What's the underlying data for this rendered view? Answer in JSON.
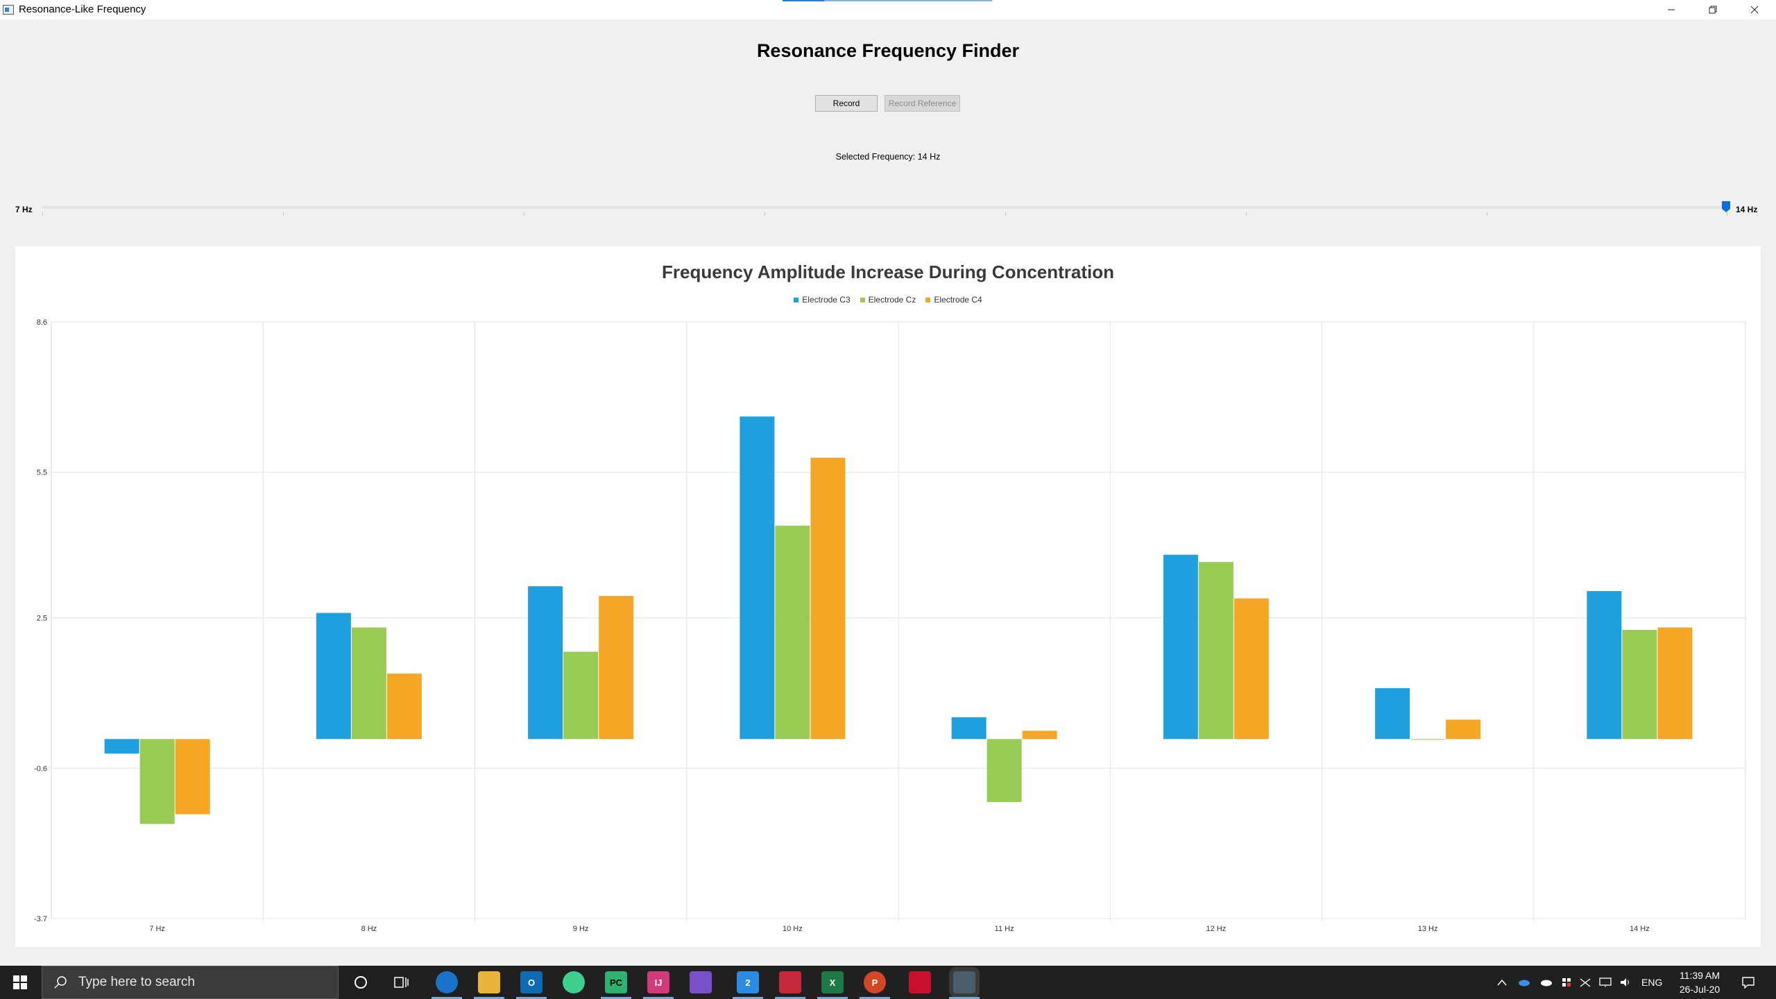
{
  "window": {
    "title": "Resonance-Like Frequency"
  },
  "app": {
    "heading": "Resonance Frequency Finder",
    "record_button": "Record",
    "record_reference_button": "Record Reference",
    "selected_frequency": "Selected Frequency: 14 Hz"
  },
  "slider": {
    "min_label": "7 Hz",
    "max_label": "14 Hz",
    "min": 7,
    "max": 14,
    "value": 14
  },
  "chart_data": {
    "type": "bar",
    "title": "Frequency Amplitude Increase During Concentration",
    "categories": [
      "7 Hz",
      "8 Hz",
      "9 Hz",
      "10 Hz",
      "11 Hz",
      "12 Hz",
      "13 Hz",
      "14 Hz"
    ],
    "series": [
      {
        "name": "Electrode C3",
        "color": "#209fdf",
        "values": [
          -0.3,
          2.6,
          3.15,
          6.65,
          0.45,
          3.8,
          1.05,
          3.05
        ]
      },
      {
        "name": "Electrode Cz",
        "color": "#99ca53",
        "values": [
          -1.75,
          2.3,
          1.8,
          4.4,
          -1.3,
          3.65,
          0.0,
          2.25
        ]
      },
      {
        "name": "Electrode C4",
        "color": "#f6a625",
        "values": [
          -1.55,
          1.35,
          2.95,
          5.8,
          0.17,
          2.9,
          0.4,
          2.3
        ]
      }
    ],
    "ylim": [
      -3.7,
      8.6
    ],
    "yticks": [
      "8.6",
      "5.5",
      "2.5",
      "-0.6",
      "-3.7"
    ],
    "grid": true,
    "legend_position": "top"
  },
  "taskbar": {
    "search_placeholder": "Type here to search",
    "language": "ENG",
    "time": "11:39 AM",
    "date": "26-Jul-20"
  }
}
